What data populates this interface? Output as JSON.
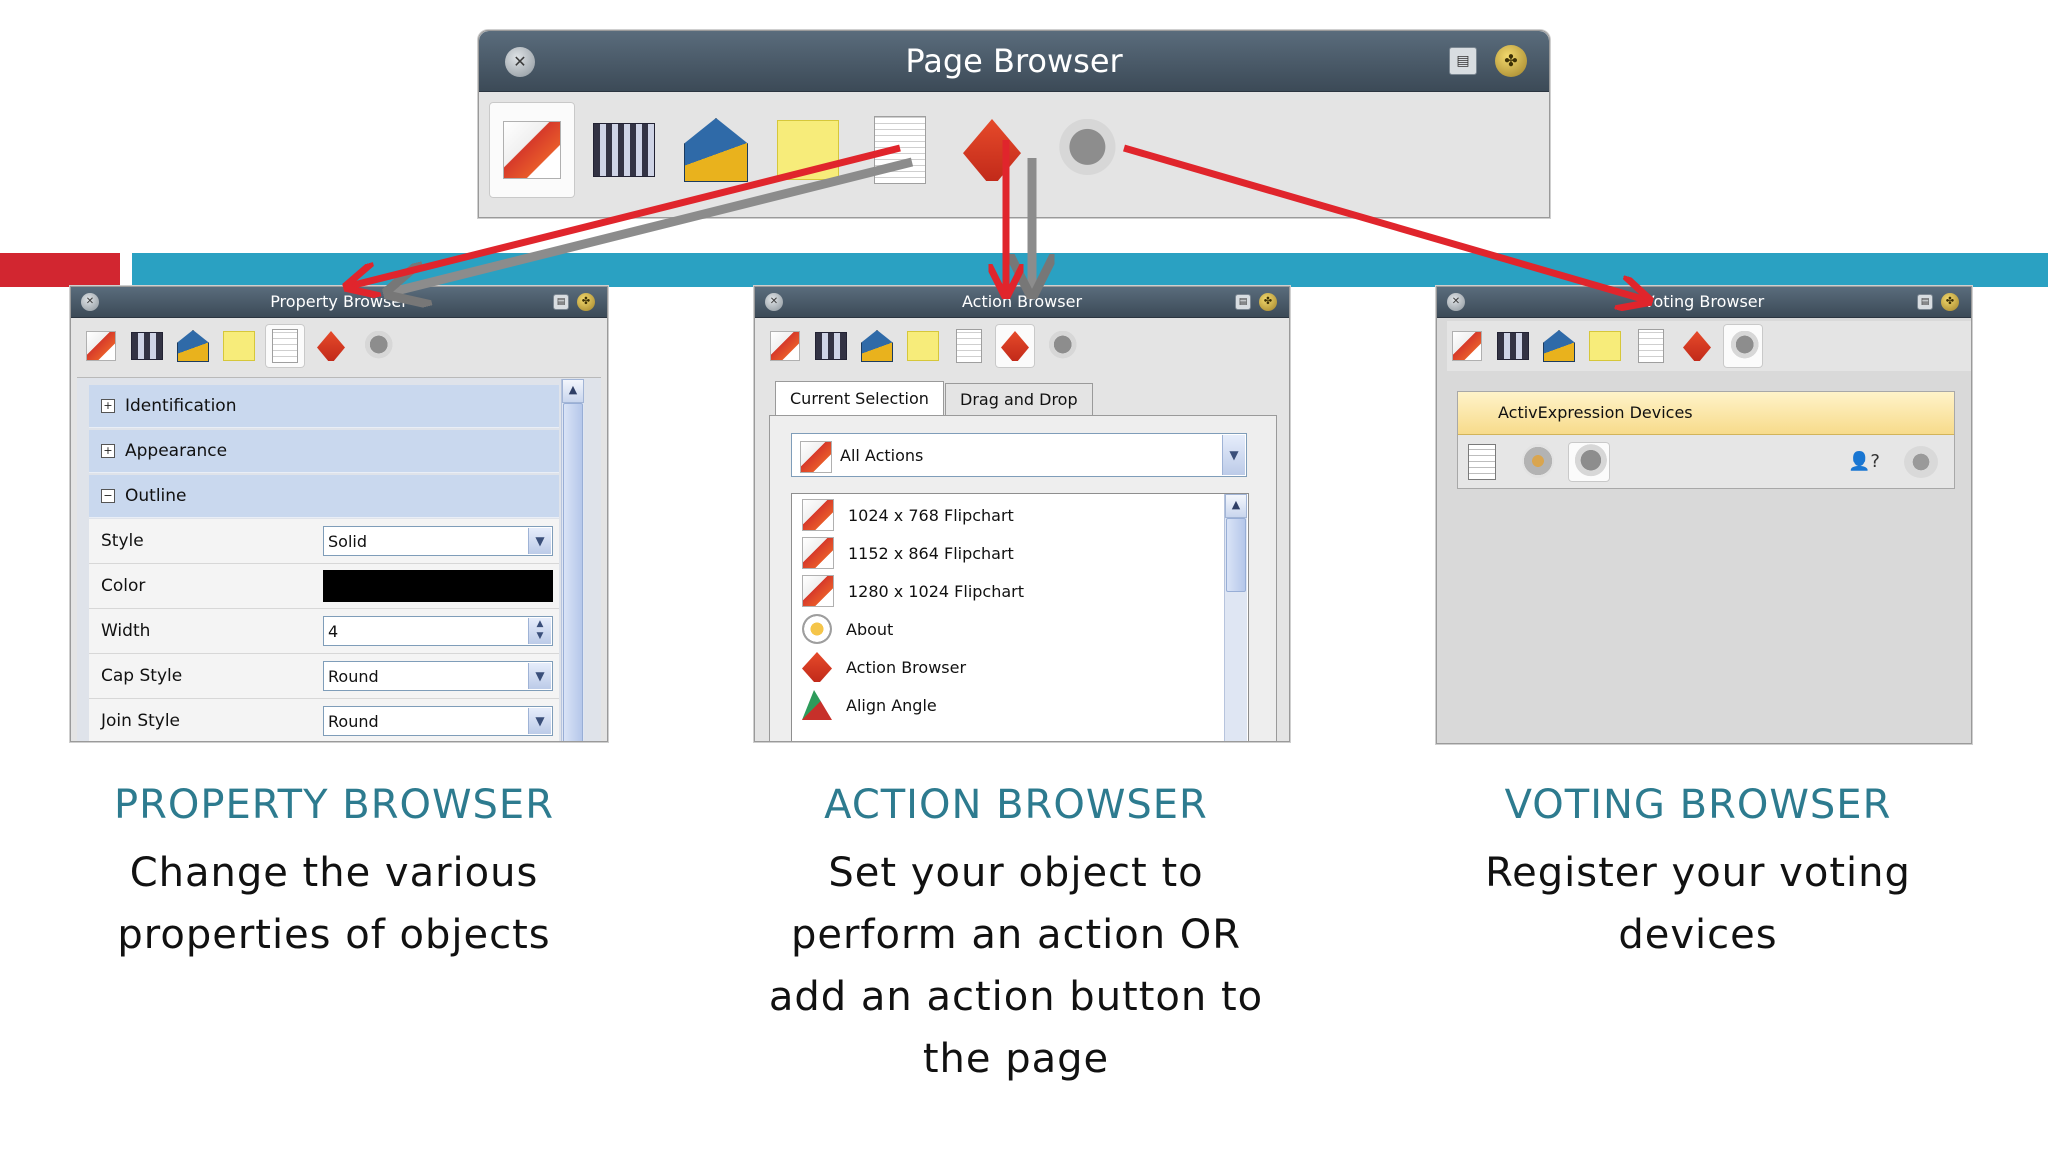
{
  "page_browser": {
    "title": "Page Browser"
  },
  "property_browser": {
    "title": "Property Browser",
    "groups": [
      "Identification",
      "Appearance",
      "Outline"
    ],
    "rows": [
      {
        "label": "Style",
        "value": "Solid"
      },
      {
        "label": "Color",
        "value": ""
      },
      {
        "label": "Width",
        "value": "4"
      },
      {
        "label": "Cap Style",
        "value": "Round"
      },
      {
        "label": "Join Style",
        "value": "Round"
      }
    ],
    "color_value_hex": "#000000"
  },
  "action_browser": {
    "title": "Action Browser",
    "tabs": [
      "Current Selection",
      "Drag and Drop"
    ],
    "filter": "All Actions",
    "items": [
      "1024 x 768 Flipchart",
      "1152 x 864 Flipchart",
      "1280 x 1024 Flipchart",
      "About",
      "Action Browser",
      "Align Angle"
    ]
  },
  "voting_browser": {
    "title": "Voting Browser",
    "devices_header": "ActivExpression Devices"
  },
  "captions": {
    "property": {
      "title": "PROPERTY BROWSER",
      "body": "Change the various properties of objects"
    },
    "action": {
      "title": "ACTION BROWSER",
      "body": "Set your object to perform an action OR add an action button to the page"
    },
    "voting": {
      "title": "VOTING BROWSER",
      "body": "Register your voting devices"
    }
  },
  "colors": {
    "accent_red": "#d22630",
    "accent_blue": "#2aa1c2",
    "caption_teal": "#2d7b8f",
    "arrow_red": "#e0252c"
  },
  "icons": [
    "page-icon",
    "resource-library-icon",
    "objects-icon",
    "notes-icon",
    "page-notes-icon",
    "action-browser-icon",
    "voting-browser-icon"
  ]
}
